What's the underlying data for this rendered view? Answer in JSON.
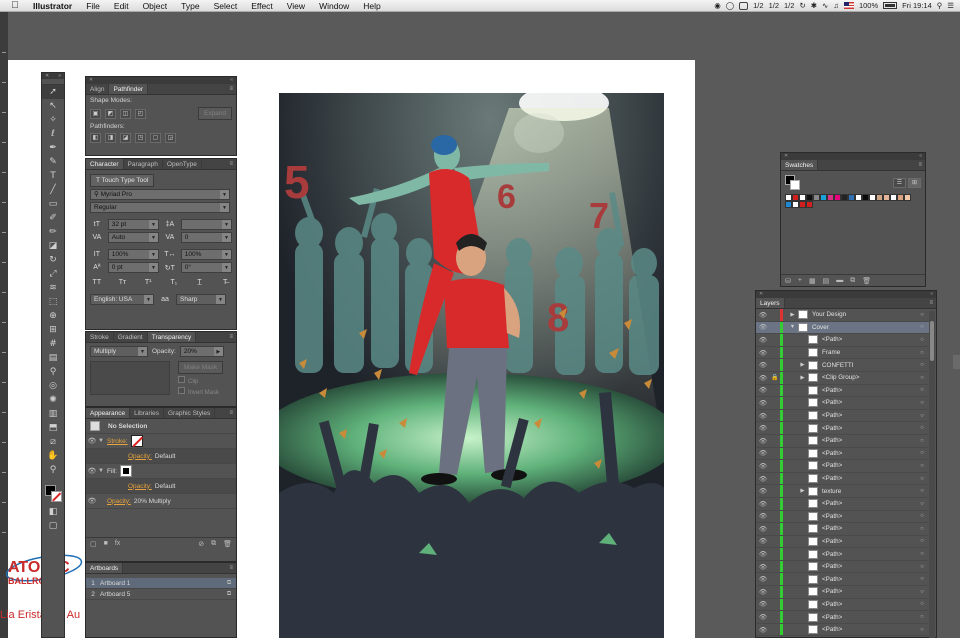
{
  "menubar": {
    "app": "Illustrator",
    "items": [
      "File",
      "Edit",
      "Object",
      "Type",
      "Select",
      "Effect",
      "View",
      "Window",
      "Help"
    ],
    "tray": {
      "half1": "1/2",
      "half2": "1/2",
      "half3": "1/2",
      "battery": "100%",
      "clock": "Fri 19:14"
    }
  },
  "artwork": {
    "numbers": [
      "5",
      "6",
      "7",
      "8"
    ]
  },
  "logo": {
    "line1": "ATOMIC",
    "line2": "BALLROOM"
  },
  "credit": "Lia Eristavi & Au",
  "pathfinder": {
    "tabs": [
      "Align",
      "Pathfinder"
    ],
    "shape_modes": "Shape Modes:",
    "expand": "Expand",
    "pathfinders": "Pathfinders:"
  },
  "character": {
    "tabs": [
      "Character",
      "Paragraph",
      "OpenType"
    ],
    "touch_tool": "Touch Type Tool",
    "font": "Myriad Pro",
    "style": "Regular",
    "size": "32 pt",
    "leading": "",
    "kerning": "Auto",
    "tracking": "0",
    "vscale": "100%",
    "hscale": "100%",
    "baseline": "0 pt",
    "rotation": "0°",
    "language": "English: USA",
    "aa": "Sharp"
  },
  "transparency": {
    "tabs": [
      "Stroke",
      "Gradient",
      "Transparency"
    ],
    "mode": "Multiply",
    "opacity_label": "Opacity:",
    "opacity": "20%",
    "make_mask": "Make Mask",
    "clip": "Clip",
    "invert": "Invert Mask"
  },
  "appearance": {
    "tabs": [
      "Appearance",
      "Libraries",
      "Graphic Styles"
    ],
    "selection": "No Selection",
    "stroke": "Stroke:",
    "stroke_opacity_label": "Opacity:",
    "stroke_opacity": "Default",
    "fill": "Fill:",
    "fill_opacity_label": "Opacity:",
    "fill_opacity": "Default",
    "obj_opacity_label": "Opacity:",
    "obj_opacity": "20% Multiply"
  },
  "artboards": {
    "title": "Artboards",
    "rows": [
      {
        "n": "1",
        "name": "Artboard 1"
      },
      {
        "n": "2",
        "name": "Artboard 5"
      }
    ]
  },
  "swatches": {
    "title": "Swatches",
    "colors": [
      "#ffffff",
      "#d11f1f",
      "#ffffff",
      "#111111",
      "#888888",
      "#1aa1d8",
      "#d63384",
      "#e6007e",
      "#222222",
      "#2f6fb3",
      "#ffffff",
      "#0a0a0a",
      "#ffffff",
      "#cfa486",
      "#e3b496",
      "#ffffff",
      "#d9a080",
      "#f2c9a8",
      "#1e88d2",
      "#ffffff",
      "#d11f1f",
      "#d11f1f"
    ]
  },
  "layers": {
    "title": "Layers",
    "rows": [
      {
        "name": "Your Design",
        "indent": 0,
        "expand": "▶",
        "lock": "",
        "color": "#d33",
        "sel": false
      },
      {
        "name": "Cover",
        "indent": 0,
        "expand": "▼",
        "lock": "",
        "color": "#3c3",
        "sel": true
      },
      {
        "name": "<Path>",
        "indent": 1,
        "expand": "",
        "lock": "",
        "color": "#3c3",
        "sel": false
      },
      {
        "name": "Frame",
        "indent": 1,
        "expand": "",
        "lock": "",
        "color": "#3c3",
        "sel": false
      },
      {
        "name": "CONFETTI",
        "indent": 1,
        "expand": "▶",
        "lock": "",
        "color": "#3c3",
        "sel": false
      },
      {
        "name": "<Clip Group>",
        "indent": 1,
        "expand": "▶",
        "lock": "🔒",
        "color": "#3c3",
        "sel": false
      },
      {
        "name": "<Path>",
        "indent": 1,
        "expand": "",
        "lock": "",
        "color": "#3c3",
        "sel": false
      },
      {
        "name": "<Path>",
        "indent": 1,
        "expand": "",
        "lock": "",
        "color": "#3c3",
        "sel": false
      },
      {
        "name": "<Path>",
        "indent": 1,
        "expand": "",
        "lock": "",
        "color": "#3c3",
        "sel": false
      },
      {
        "name": "<Path>",
        "indent": 1,
        "expand": "",
        "lock": "",
        "color": "#3c3",
        "sel": false
      },
      {
        "name": "<Path>",
        "indent": 1,
        "expand": "",
        "lock": "",
        "color": "#3c3",
        "sel": false
      },
      {
        "name": "<Path>",
        "indent": 1,
        "expand": "",
        "lock": "",
        "color": "#3c3",
        "sel": false
      },
      {
        "name": "<Path>",
        "indent": 1,
        "expand": "",
        "lock": "",
        "color": "#3c3",
        "sel": false
      },
      {
        "name": "<Path>",
        "indent": 1,
        "expand": "",
        "lock": "",
        "color": "#3c3",
        "sel": false
      },
      {
        "name": "texture",
        "indent": 1,
        "expand": "▶",
        "lock": "",
        "color": "#3c3",
        "sel": false
      },
      {
        "name": "<Path>",
        "indent": 1,
        "expand": "",
        "lock": "",
        "color": "#3c3",
        "sel": false
      },
      {
        "name": "<Path>",
        "indent": 1,
        "expand": "",
        "lock": "",
        "color": "#3c3",
        "sel": false
      },
      {
        "name": "<Path>",
        "indent": 1,
        "expand": "",
        "lock": "",
        "color": "#3c3",
        "sel": false
      },
      {
        "name": "<Path>",
        "indent": 1,
        "expand": "",
        "lock": "",
        "color": "#3c3",
        "sel": false
      },
      {
        "name": "<Path>",
        "indent": 1,
        "expand": "",
        "lock": "",
        "color": "#3c3",
        "sel": false
      },
      {
        "name": "<Path>",
        "indent": 1,
        "expand": "",
        "lock": "",
        "color": "#3c3",
        "sel": false
      },
      {
        "name": "<Path>",
        "indent": 1,
        "expand": "",
        "lock": "",
        "color": "#3c3",
        "sel": false
      },
      {
        "name": "<Path>",
        "indent": 1,
        "expand": "",
        "lock": "",
        "color": "#3c3",
        "sel": false
      },
      {
        "name": "<Path>",
        "indent": 1,
        "expand": "",
        "lock": "",
        "color": "#3c3",
        "sel": false
      },
      {
        "name": "<Path>",
        "indent": 1,
        "expand": "",
        "lock": "",
        "color": "#3c3",
        "sel": false
      },
      {
        "name": "<Path>",
        "indent": 1,
        "expand": "",
        "lock": "",
        "color": "#3c3",
        "sel": false
      }
    ]
  }
}
